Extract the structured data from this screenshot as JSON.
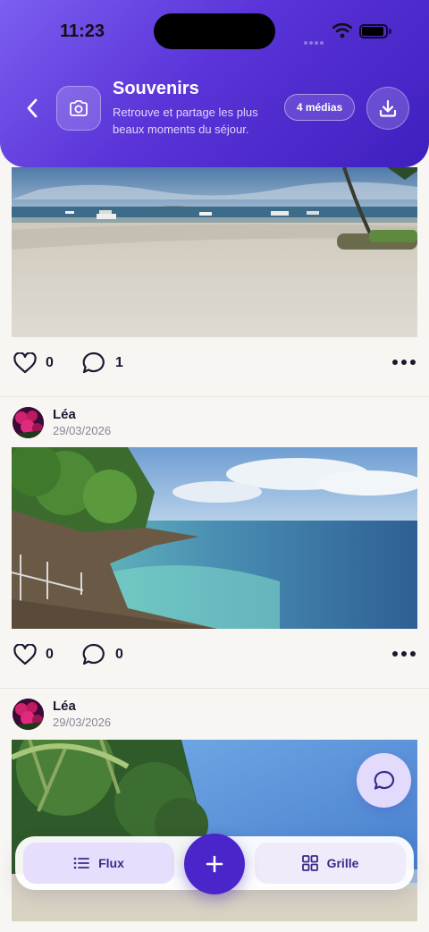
{
  "status_bar": {
    "time": "11:23"
  },
  "header": {
    "title": "Souvenirs",
    "subtitle": "Retrouve et partage les plus beaux moments du séjour.",
    "media_badge": "4 médias"
  },
  "posts": [
    {
      "author": "",
      "date": "",
      "likes": "0",
      "comments": "1",
      "scene": "beach-boats"
    },
    {
      "author": "Léa",
      "date": "29/03/2026",
      "likes": "0",
      "comments": "0",
      "scene": "rocky-coast"
    },
    {
      "author": "Léa",
      "date": "29/03/2026",
      "likes": "",
      "comments": "",
      "scene": "tropical-beach"
    }
  ],
  "bottom_nav": {
    "flux_label": "Flux",
    "grille_label": "Grille"
  },
  "icons": {
    "back": "chevron-left-icon",
    "camera": "camera-icon",
    "download": "download-icon",
    "like": "heart-icon",
    "comment": "comment-icon",
    "more": "more-horizontal-icon",
    "chat": "chat-bubble-icon",
    "add": "plus-icon",
    "list": "list-icon",
    "grid": "grid-icon"
  },
  "colors": {
    "accent": "#4a25c9",
    "header_gradient_start": "#7c5ef0",
    "header_gradient_end": "#3f1fbf",
    "background": "#f8f6f3"
  }
}
